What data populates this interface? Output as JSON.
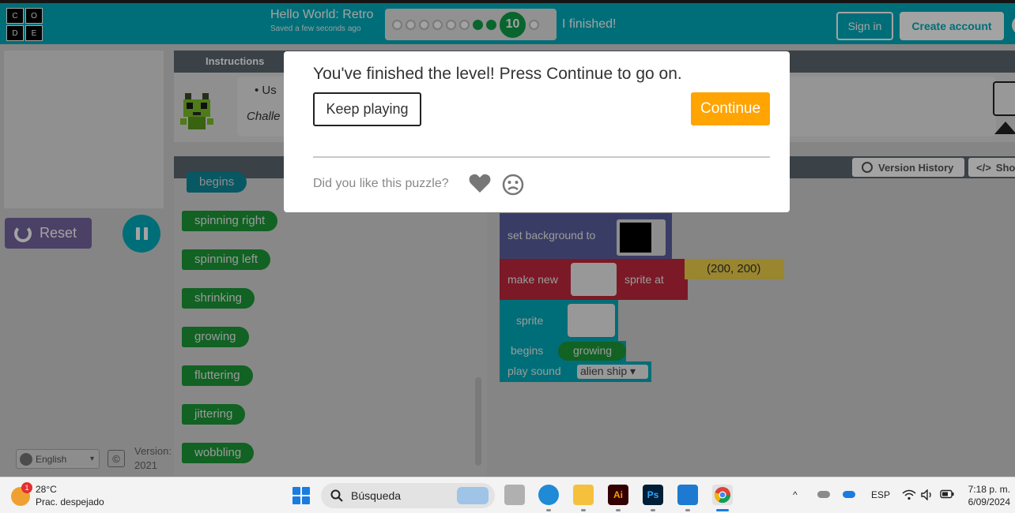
{
  "header": {
    "logo_letters": [
      "C",
      "O",
      "D",
      "E"
    ],
    "title": "Hello World: Retro",
    "saved_status": "Saved a few seconds ago",
    "current_level": "10",
    "progress_status": "I finished!",
    "sign_in_label": "Sign in",
    "create_account_label": "Create account"
  },
  "left_panel": {
    "reset_label": "Reset",
    "language": "English",
    "version_label": "Version:",
    "version_value": "2021"
  },
  "instructions": {
    "tab_label": "Instructions",
    "bullet_text": "Us",
    "challenge_text": "Challe"
  },
  "workspace": {
    "version_history_label": "Version History",
    "show_code_label": "Sho",
    "toolbox_blocks": [
      "begins",
      "spinning right",
      "spinning left",
      "shrinking",
      "growing",
      "fluttering",
      "jittering",
      "wobbling"
    ],
    "set_background_label": "set background to",
    "make_new_label": "make new",
    "sprite_at_label": "sprite at",
    "coordinates": "(200, 200)",
    "sprite_label": "sprite",
    "begins_label": "begins",
    "growing_label": "growing",
    "play_sound_label": "play sound",
    "sound_value": "alien ship"
  },
  "modal": {
    "title": "You've finished the level! Press Continue to go on.",
    "keep_playing_label": "Keep playing",
    "continue_label": "Continue",
    "feedback_question": "Did you like this puzzle?"
  },
  "taskbar": {
    "weather_badge": "1",
    "temperature": "28°C",
    "weather_condition": "Prac. despejado",
    "search_placeholder": "Búsqueda",
    "illustrator_label": "Ai",
    "photoshop_label": "Ps",
    "language_indicator": "ESP",
    "time": "7:18 p. m.",
    "date": "6/09/2024"
  },
  "colors": {
    "header_teal": "#00adbc",
    "continue_orange": "#ffa400",
    "reset_purple": "#7665a0",
    "block_green": "#1b9a38",
    "block_red": "#c0283c",
    "block_indigo": "#5960a0"
  }
}
